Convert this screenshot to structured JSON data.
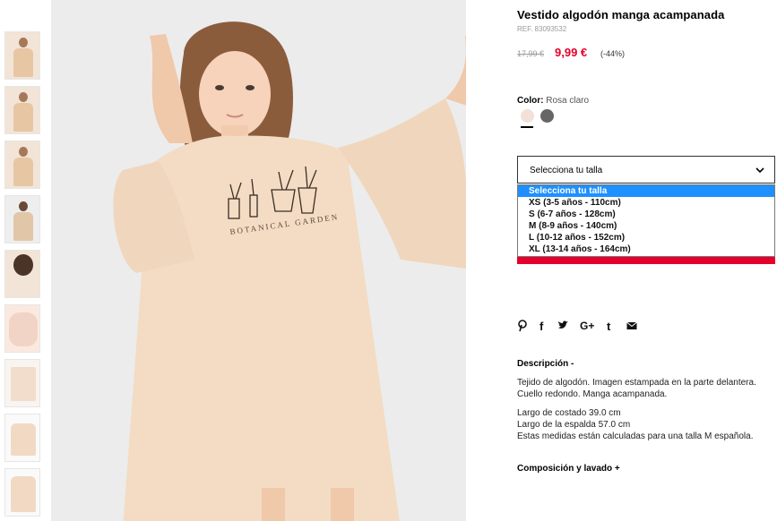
{
  "product": {
    "title": "Vestido algodón manga acampanada",
    "ref": "REF. 83093532",
    "old_price": "17,99 €",
    "new_price": "9,99 €",
    "discount": "(-44%)"
  },
  "color": {
    "label": "Color:",
    "value": "Rosa claro",
    "swatches": [
      "#f1e1d6",
      "#666666"
    ]
  },
  "size_select": {
    "current": "Selecciona tu talla",
    "options": [
      "Selecciona tu talla",
      "XS (3-5 años - 110cm)",
      "S (6-7 años - 128cm)",
      "M (8-9 años - 140cm)",
      "L (10-12 años - 152cm)",
      "XL (13-14 años - 164cm)"
    ]
  },
  "share_icons": [
    "pinterest-icon",
    "facebook-icon",
    "twitter-icon",
    "google-plus-icon",
    "tumblr-icon",
    "mail-icon"
  ],
  "description": {
    "title": "Descripción -",
    "line1": "Tejido de algodón. Imagen estampada en la parte delantera.",
    "line2": "Cuello redondo. Manga acampanada.",
    "line3": "Largo de costado 39.0 cm",
    "line4": "Largo de la espalda 57.0 cm",
    "line5": "Estas medidas están calculadas para una talla M española."
  },
  "composition": {
    "title": "Composición y lavado +"
  },
  "image_print": "BOTANICAL GARDEN"
}
